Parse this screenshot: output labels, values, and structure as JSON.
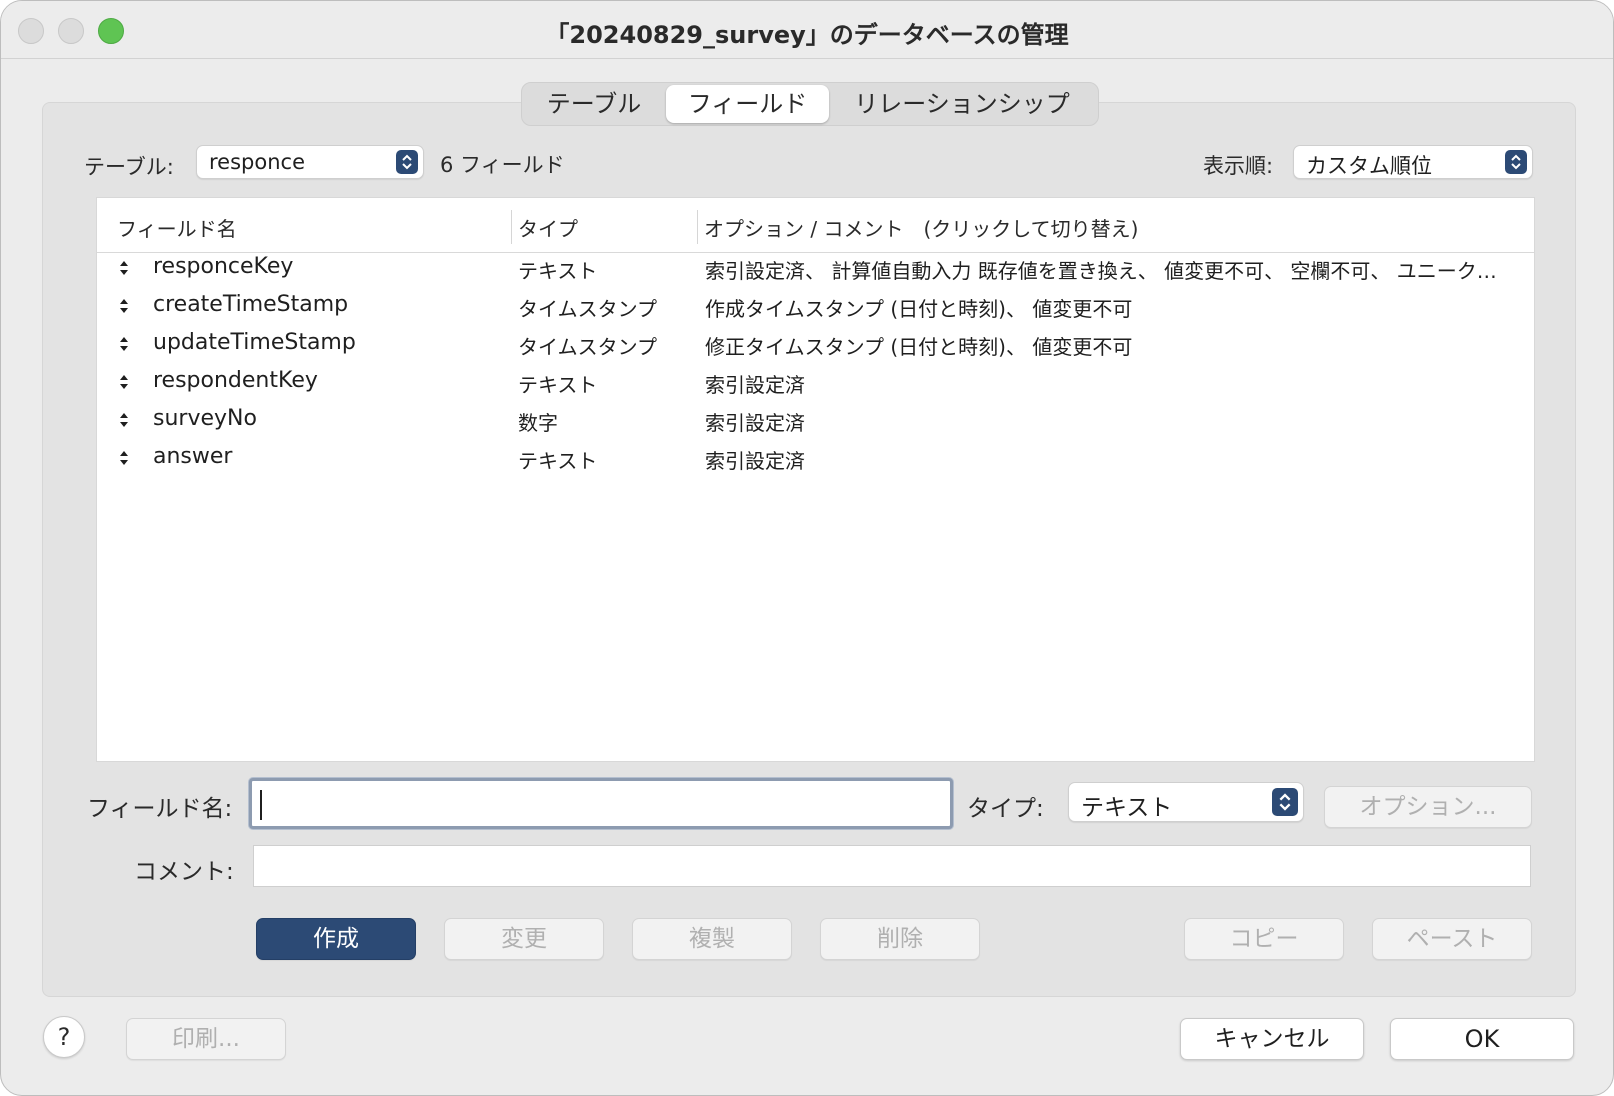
{
  "window": {
    "title": "「20240829_survey」のデータベースの管理"
  },
  "tabs": [
    {
      "label": "テーブル"
    },
    {
      "label": "フィールド",
      "selected": true
    },
    {
      "label": "リレーションシップ"
    }
  ],
  "table_selector": {
    "label": "テーブル:",
    "value": "responce",
    "count_text": "6 フィールド"
  },
  "sort_selector": {
    "label": "表示順:",
    "value": "カスタム順位"
  },
  "field_list": {
    "headers": {
      "name": "フィールド名",
      "type": "タイプ",
      "options": "オプション / コメント　(クリックして切り替え)"
    },
    "rows": [
      {
        "name": "responceKey",
        "type": "テキスト",
        "options": "索引設定済、 計算値自動入力  既存値を置き換え、 値変更不可、 空欄不可、 ユニーク…"
      },
      {
        "name": "createTimeStamp",
        "type": "タイムスタンプ",
        "options": "作成タイムスタンプ (日付と時刻)、 値変更不可"
      },
      {
        "name": "updateTimeStamp",
        "type": "タイムスタンプ",
        "options": "修正タイムスタンプ (日付と時刻)、 値変更不可"
      },
      {
        "name": "respondentKey",
        "type": "テキスト",
        "options": "索引設定済"
      },
      {
        "name": "surveyNo",
        "type": "数字",
        "options": "索引設定済"
      },
      {
        "name": "answer",
        "type": "テキスト",
        "options": "索引設定済"
      }
    ]
  },
  "editor": {
    "field_name_label": "フィールド名:",
    "field_name_value": "",
    "type_label": "タイプ:",
    "type_value": "テキスト",
    "options_button": "オプション...",
    "comment_label": "コメント:",
    "comment_value": ""
  },
  "actions": {
    "create": "作成",
    "change": "変更",
    "duplicate": "複製",
    "delete": "削除",
    "copy": "コピー",
    "paste": "ペースト"
  },
  "footer": {
    "help": "?",
    "print": "印刷...",
    "cancel": "キャンセル",
    "ok": "OK"
  },
  "colors": {
    "accent": "#2c4a75",
    "zoom_button": "#5fc453",
    "window_bg": "#ececec"
  }
}
